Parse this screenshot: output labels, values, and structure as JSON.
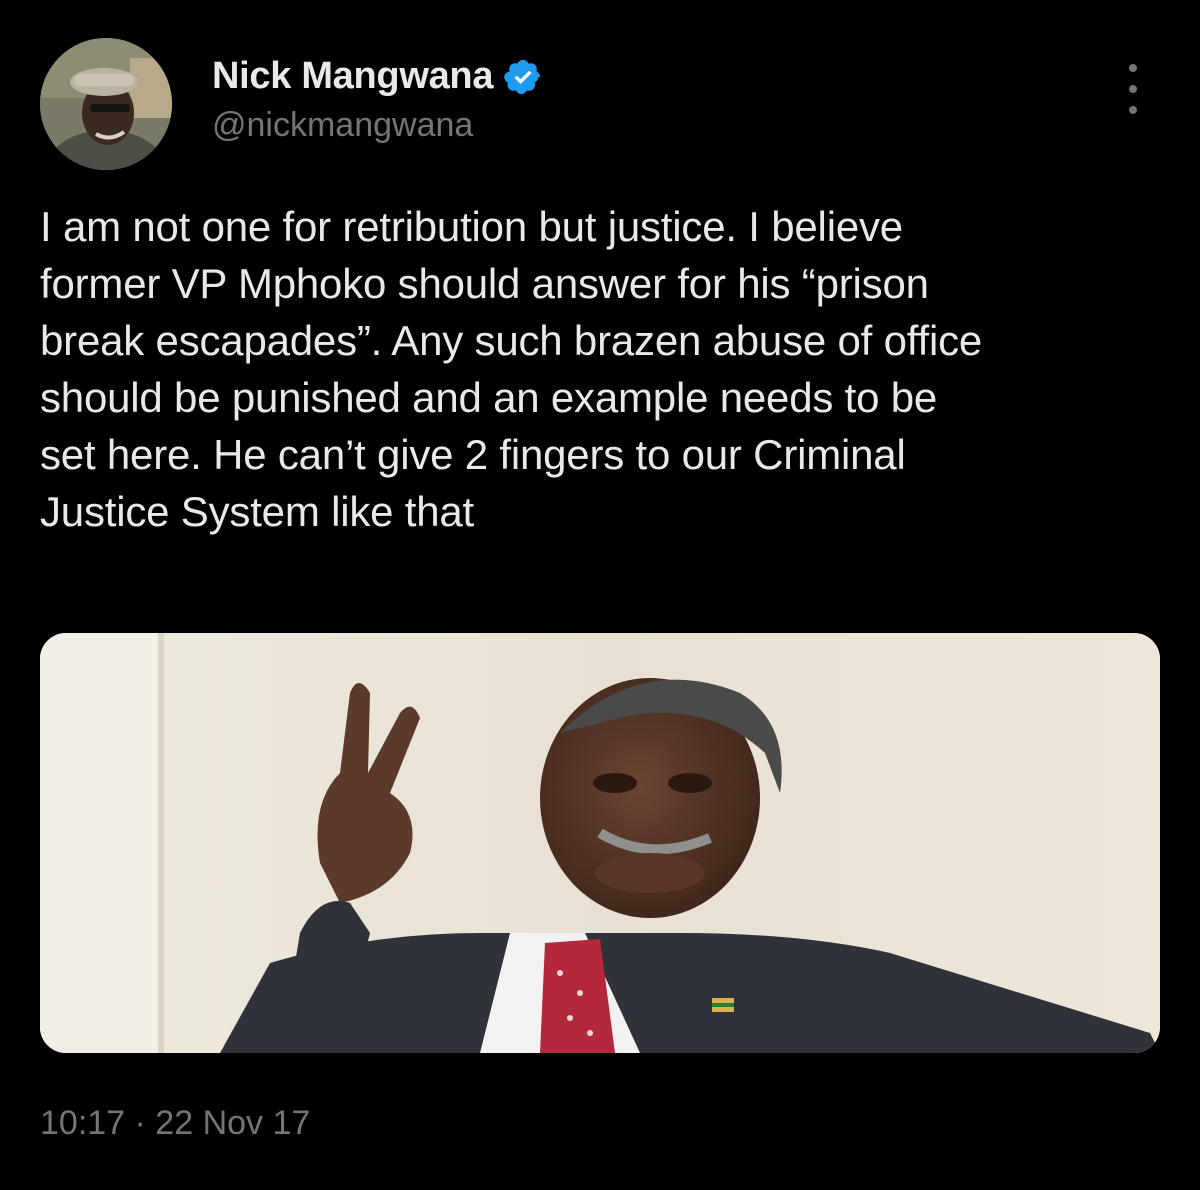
{
  "author": {
    "display_name": "Nick Mangwana",
    "handle": "@nickmangwana",
    "verified_icon": "verified-badge-icon",
    "verified_color": "#1d9bf0"
  },
  "tweet": {
    "text": "I am not one for retribution but justice. I believe\nformer VP Mphoko should answer for his “prison\nbreak escapades”. Any such brazen abuse of office\nshould be punished and an example needs to be\nset here. He can’t give 2 fingers to our Criminal\nJustice System like that",
    "media_description_icon": "photo-man-peace-sign",
    "timestamp": "10:17 · 22 Nov 17"
  },
  "actions": {
    "more_icon": "more-vertical-icon"
  },
  "colors": {
    "background": "#000000",
    "primary_text": "#e7e9ea",
    "secondary_text": "#71767b"
  }
}
